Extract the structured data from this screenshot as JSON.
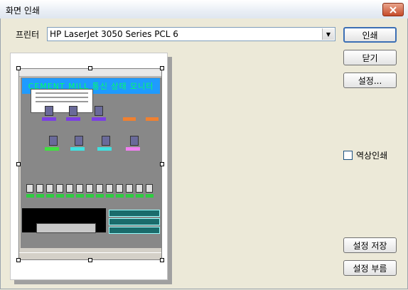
{
  "window": {
    "title": "화면 인쇄"
  },
  "printer": {
    "label": "프린터",
    "selected": "HP LaserJet 3050 Series PCL 6"
  },
  "buttons": {
    "print": "인쇄",
    "close": "닫기",
    "settings": "설정...",
    "save_settings": "설정 저장",
    "load_settings": "설정 부름"
  },
  "options": {
    "reverse_print_label": "역상인쇄",
    "reverse_print_checked": false
  },
  "preview": {
    "banner_text": "CEMENT MILL 통신 상태 모니터"
  },
  "icons": {
    "close": "close-icon",
    "dropdown": "chevron-down-icon"
  }
}
